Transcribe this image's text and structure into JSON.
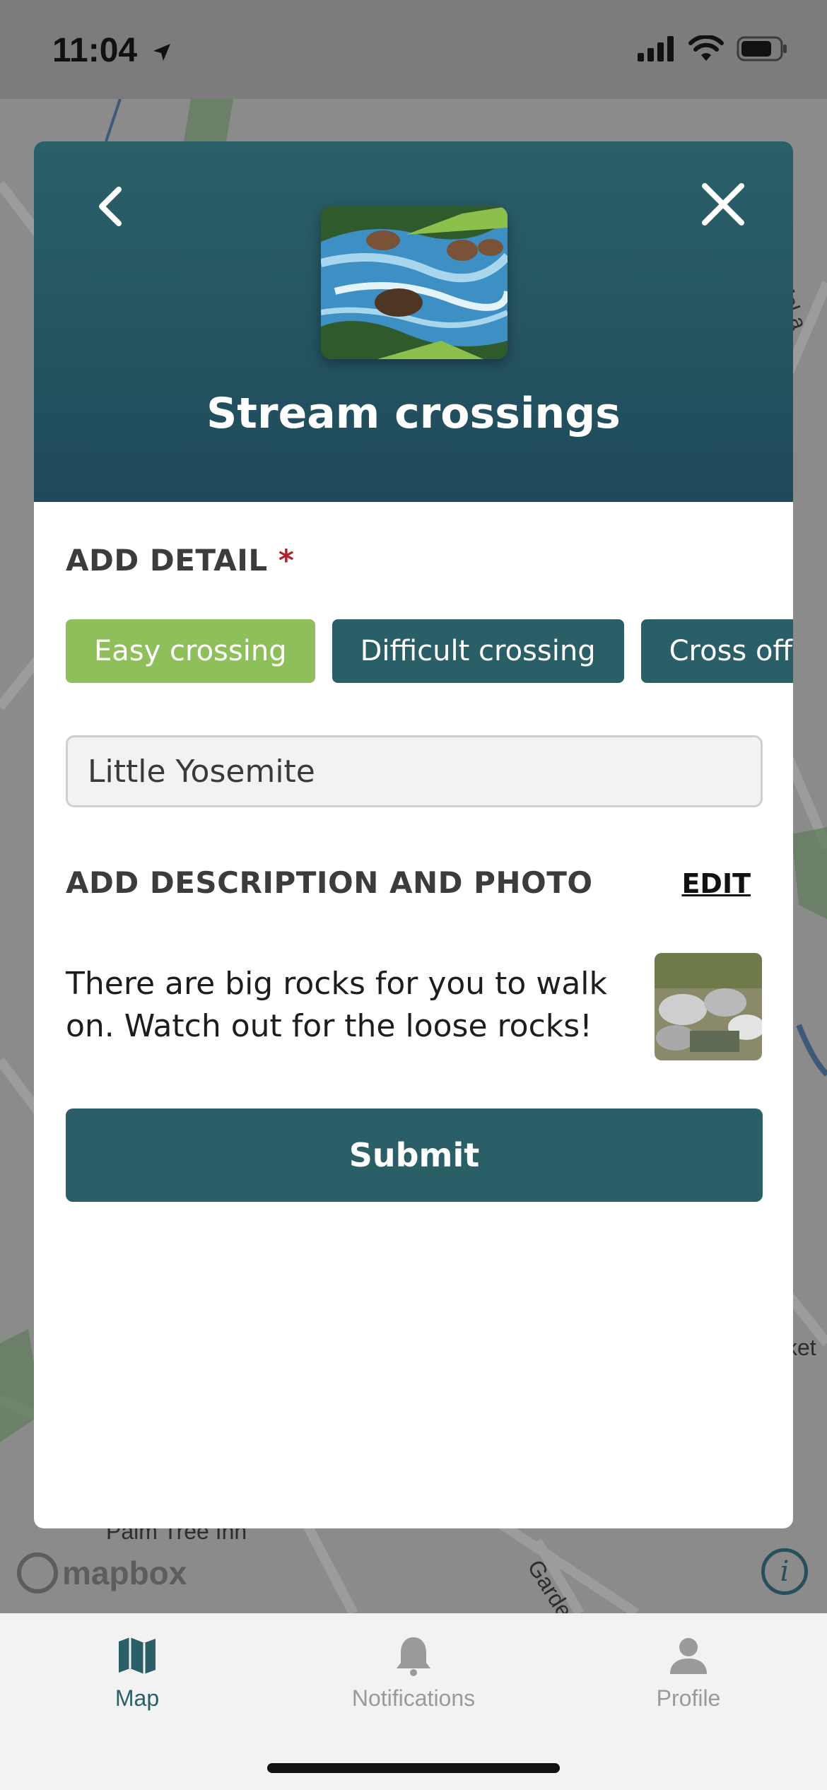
{
  "status_bar": {
    "time": "11:04"
  },
  "map": {
    "labels": [
      "Palm Tree Inn",
      "Garden Ave",
      "McLa",
      "ket"
    ],
    "attribution": "mapbox",
    "info_icon": "info-icon"
  },
  "modal": {
    "title": "Stream crossings",
    "add_detail_heading": "ADD DETAIL",
    "required_marker": "*",
    "chips": [
      {
        "label": "Easy crossing",
        "selected": true
      },
      {
        "label": "Difficult crossing",
        "selected": false
      },
      {
        "label": "Cross off trail",
        "selected": false
      }
    ],
    "location_value": "Little Yosemite",
    "description_heading": "ADD DESCRIPTION AND PHOTO",
    "edit_label": "EDIT",
    "description_text": "There are big rocks for you to walk on. Watch out for the loose rocks!",
    "submit_label": "Submit"
  },
  "tab_bar": {
    "tabs": [
      {
        "label": "Map",
        "icon": "map-icon",
        "active": true
      },
      {
        "label": "Notifications",
        "icon": "bell-icon",
        "active": false
      },
      {
        "label": "Profile",
        "icon": "person-icon",
        "active": false
      }
    ]
  },
  "colors": {
    "header_teal": "#2b6068",
    "button_teal": "#2b5f67",
    "chip_selected": "#8fbf5a",
    "required_red": "#b3222b"
  }
}
